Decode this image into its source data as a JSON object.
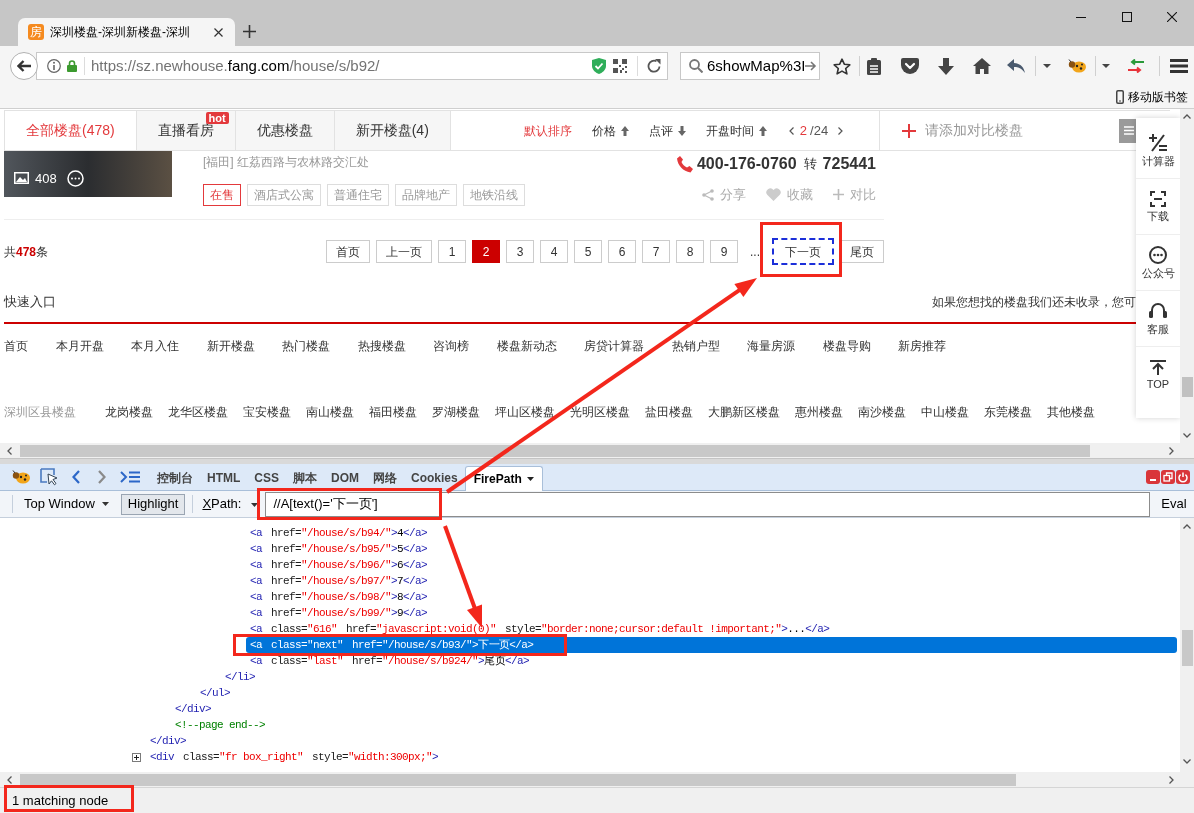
{
  "browser": {
    "tab": {
      "icon_text": "房",
      "title": "深圳楼盘-深圳新楼盘-深圳"
    },
    "address": {
      "prefix": "https://sz.newhouse.",
      "domain": "fang.com",
      "path": "/house/s/b92/"
    },
    "search": {
      "value": "6showMap%3I"
    },
    "bookmarks": [
      {
        "label": "移动版书签"
      }
    ]
  },
  "page": {
    "nav_tabs": [
      {
        "label": "全部楼盘(478)",
        "selected": true
      },
      {
        "label": "直播看房",
        "selected": false,
        "badge": "hot"
      },
      {
        "label": "优惠楼盘",
        "selected": false
      },
      {
        "label": "新开楼盘(4)",
        "selected": false
      }
    ],
    "sort_options": [
      {
        "label": "默认排序",
        "selected": true
      },
      {
        "label": "价格",
        "selected": false,
        "ascending": true
      },
      {
        "label": "点评",
        "selected": false,
        "ascending": false
      },
      {
        "label": "开盘时间",
        "selected": false,
        "ascending": true
      }
    ],
    "page_indicator": {
      "current": "2",
      "total": "/24"
    },
    "compare_prompt": "请添加对比楼盘",
    "listing": {
      "photo_count": "408",
      "address": "[福田] 红荔西路与农林路交汇处",
      "tags": [
        {
          "label": "在售",
          "highlighted": true
        },
        {
          "label": "酒店式公寓",
          "highlighted": false
        },
        {
          "label": "普通住宅",
          "highlighted": false
        },
        {
          "label": "品牌地产",
          "highlighted": false
        },
        {
          "label": "地铁沿线",
          "highlighted": false
        }
      ],
      "phone": "400-176-0760",
      "extension_label": "转",
      "extension": "725441",
      "actions": [
        {
          "kind": "share",
          "label": "分享"
        },
        {
          "kind": "favorite",
          "label": "收藏"
        },
        {
          "kind": "compare",
          "label": "对比"
        }
      ]
    },
    "pagination": {
      "total": "共**478**条",
      "pages": [
        {
          "kind": "button",
          "label": "首页",
          "selected": false,
          "focused": false
        },
        {
          "kind": "button",
          "label": "上一页",
          "selected": false,
          "focused": false
        },
        {
          "kind": "button",
          "label": "1",
          "selected": false,
          "focused": false
        },
        {
          "kind": "button",
          "label": "2",
          "selected": true,
          "focused": false
        },
        {
          "kind": "button",
          "label": "3",
          "selected": false,
          "focused": false
        },
        {
          "kind": "button",
          "label": "4",
          "selected": false,
          "focused": false
        },
        {
          "kind": "button",
          "label": "5",
          "selected": false,
          "focused": false
        },
        {
          "kind": "button",
          "label": "6",
          "selected": false,
          "focused": false
        },
        {
          "kind": "button",
          "label": "7",
          "selected": false,
          "focused": false
        },
        {
          "kind": "button",
          "label": "8",
          "selected": false,
          "focused": false
        },
        {
          "kind": "button",
          "label": "9",
          "selected": false,
          "focused": false
        },
        {
          "kind": "gap",
          "label": "..."
        },
        {
          "kind": "button",
          "label": "下一页",
          "selected": false,
          "focused": true
        },
        {
          "kind": "button",
          "label": "尾页",
          "selected": false,
          "focused": false
        }
      ]
    },
    "quick_entry": {
      "title": "快速入口",
      "notice": "如果您想找的楼盘我们还未收录，您可"
    },
    "links": [
      "首页",
      "本月开盘",
      "本月入住",
      "新开楼盘",
      "热门楼盘",
      "热搜楼盘",
      "咨询榜",
      "楼盘新动态",
      "房贷计算器",
      "热销户型",
      "海量房源",
      "楼盘导购",
      "新房推荐"
    ],
    "districts": {
      "title": "深圳区县楼盘",
      "items": [
        "龙岗楼盘",
        "龙华区楼盘",
        "宝安楼盘",
        "南山楼盘",
        "福田楼盘",
        "罗湖楼盘",
        "坪山区楼盘",
        "光明区楼盘",
        "盐田楼盘",
        "大鹏新区楼盘",
        "惠州楼盘",
        "南沙楼盘",
        "中山楼盘",
        "东莞楼盘",
        "其他楼盘"
      ]
    },
    "side_tools": [
      {
        "kind": "calculator",
        "label": "计算器"
      },
      {
        "kind": "download",
        "label": "下载"
      },
      {
        "kind": "wechat",
        "label": "公众号"
      },
      {
        "kind": "service",
        "label": "客服"
      },
      {
        "kind": "top",
        "label": "TOP"
      }
    ]
  },
  "devtools": {
    "tabs": [
      {
        "label": "控制台",
        "selected": false,
        "menu": false
      },
      {
        "label": "HTML",
        "selected": false,
        "menu": false
      },
      {
        "label": "CSS",
        "selected": false,
        "menu": false
      },
      {
        "label": "脚本",
        "selected": false,
        "menu": false
      },
      {
        "label": "DOM",
        "selected": false,
        "menu": false
      },
      {
        "label": "网络",
        "selected": false,
        "menu": false
      },
      {
        "label": "Cookies",
        "selected": false,
        "menu": false
      },
      {
        "label": "FirePath",
        "selected": true,
        "menu": true
      }
    ],
    "frame_menu": "Top Window",
    "highlight": {
      "label": "Highlight",
      "pressed": true
    },
    "xpath_label": "XPath:",
    "query": "//A[text()='下一页']",
    "eval": "Eval",
    "tree": [
      {
        "selected": false,
        "close": [
          {
            "kind": "tag",
            "text": "</div>"
          }
        ],
        "children": [
          {
            "selected": false,
            "close": [
              {
                "kind": "tag",
                "text": "</div>"
              }
            ],
            "children": [
              {
                "selected": false,
                "close": [
                  {
                    "kind": "tag",
                    "text": "</ul>"
                  }
                ],
                "children": [
                  {
                    "selected": false,
                    "close": [
                      {
                        "kind": "tag",
                        "text": "</li>"
                      }
                    ],
                    "children": [
                      {
                        "selected": false,
                        "tokens": [
                          {
                            "kind": "tag",
                            "text": "<a"
                          },
                          {
                            "kind": "attr",
                            "text": "href="
                          },
                          {
                            "kind": "value",
                            "text": "\"/house/s/b94/\""
                          },
                          {
                            "kind": "tag",
                            "text": ">"
                          },
                          {
                            "kind": "text",
                            "text": "4"
                          },
                          {
                            "kind": "tag",
                            "text": "</a>"
                          }
                        ]
                      },
                      {
                        "selected": false,
                        "tokens": [
                          {
                            "kind": "tag",
                            "text": "<a"
                          },
                          {
                            "kind": "attr",
                            "text": "href="
                          },
                          {
                            "kind": "value",
                            "text": "\"/house/s/b95/\""
                          },
                          {
                            "kind": "tag",
                            "text": ">"
                          },
                          {
                            "kind": "text",
                            "text": "5"
                          },
                          {
                            "kind": "tag",
                            "text": "</a>"
                          }
                        ]
                      },
                      {
                        "selected": false,
                        "tokens": [
                          {
                            "kind": "tag",
                            "text": "<a"
                          },
                          {
                            "kind": "attr",
                            "text": "href="
                          },
                          {
                            "kind": "value",
                            "text": "\"/house/s/b96/\""
                          },
                          {
                            "kind": "tag",
                            "text": ">"
                          },
                          {
                            "kind": "text",
                            "text": "6"
                          },
                          {
                            "kind": "tag",
                            "text": "</a>"
                          }
                        ]
                      },
                      {
                        "selected": false,
                        "tokens": [
                          {
                            "kind": "tag",
                            "text": "<a"
                          },
                          {
                            "kind": "attr",
                            "text": "href="
                          },
                          {
                            "kind": "value",
                            "text": "\"/house/s/b97/\""
                          },
                          {
                            "kind": "tag",
                            "text": ">"
                          },
                          {
                            "kind": "text",
                            "text": "7"
                          },
                          {
                            "kind": "tag",
                            "text": "</a>"
                          }
                        ]
                      },
                      {
                        "selected": false,
                        "tokens": [
                          {
                            "kind": "tag",
                            "text": "<a"
                          },
                          {
                            "kind": "attr",
                            "text": "href="
                          },
                          {
                            "kind": "value",
                            "text": "\"/house/s/b98/\""
                          },
                          {
                            "kind": "tag",
                            "text": ">"
                          },
                          {
                            "kind": "text",
                            "text": "8"
                          },
                          {
                            "kind": "tag",
                            "text": "</a>"
                          }
                        ]
                      },
                      {
                        "selected": false,
                        "tokens": [
                          {
                            "kind": "tag",
                            "text": "<a"
                          },
                          {
                            "kind": "attr",
                            "text": "href="
                          },
                          {
                            "kind": "value",
                            "text": "\"/house/s/b99/\""
                          },
                          {
                            "kind": "tag",
                            "text": ">"
                          },
                          {
                            "kind": "text",
                            "text": "9"
                          },
                          {
                            "kind": "tag",
                            "text": "</a>"
                          }
                        ]
                      },
                      {
                        "selected": false,
                        "tokens": [
                          {
                            "kind": "tag",
                            "text": "<a"
                          },
                          {
                            "kind": "attr",
                            "text": "class="
                          },
                          {
                            "kind": "value",
                            "text": "\"616\""
                          },
                          {
                            "kind": "attr",
                            "text": "href="
                          },
                          {
                            "kind": "value",
                            "text": "\"javascript:void(0)\""
                          },
                          {
                            "kind": "attr",
                            "text": "style="
                          },
                          {
                            "kind": "value",
                            "text": "\"border:none;cursor:default !important;\""
                          },
                          {
                            "kind": "tag",
                            "text": ">"
                          },
                          {
                            "kind": "text",
                            "text": "..."
                          },
                          {
                            "kind": "tag",
                            "text": "</a>"
                          }
                        ]
                      },
                      {
                        "selected": true,
                        "tokens": [
                          {
                            "kind": "tag",
                            "text": "<a"
                          },
                          {
                            "kind": "attr",
                            "text": "class="
                          },
                          {
                            "kind": "value",
                            "text": "\"next\""
                          },
                          {
                            "kind": "attr",
                            "text": "href="
                          },
                          {
                            "kind": "value",
                            "text": "\"/house/s/b93/\""
                          },
                          {
                            "kind": "tag",
                            "text": ">"
                          },
                          {
                            "kind": "text",
                            "text": "下一页"
                          },
                          {
                            "kind": "tag",
                            "text": "</a>"
                          }
                        ]
                      },
                      {
                        "selected": false,
                        "tokens": [
                          {
                            "kind": "tag",
                            "text": "<a"
                          },
                          {
                            "kind": "attr",
                            "text": "class="
                          },
                          {
                            "kind": "value",
                            "text": "\"last\""
                          },
                          {
                            "kind": "attr",
                            "text": "href="
                          },
                          {
                            "kind": "value",
                            "text": "\"/house/s/b924/\""
                          },
                          {
                            "kind": "tag",
                            "text": ">"
                          },
                          {
                            "kind": "text",
                            "text": "尾页"
                          },
                          {
                            "kind": "tag",
                            "text": "</a>"
                          }
                        ]
                      }
                    ]
                  }
                ]
              }
            ]
          },
          {
            "selected": false,
            "tokens": [
              {
                "kind": "comment",
                "text": "<!--page end-->"
              }
            ]
          }
        ]
      },
      {
        "selected": false,
        "expanded": false,
        "tokens": [
          {
            "kind": "tag",
            "text": "<div"
          },
          {
            "kind": "attr",
            "text": "class="
          },
          {
            "kind": "value",
            "text": "\"fr box_right\""
          },
          {
            "kind": "attr",
            "text": "style="
          },
          {
            "kind": "value",
            "text": "\"width:300px;\""
          },
          {
            "kind": "tag",
            "text": ">"
          }
        ]
      }
    ],
    "status": "1 matching node"
  }
}
